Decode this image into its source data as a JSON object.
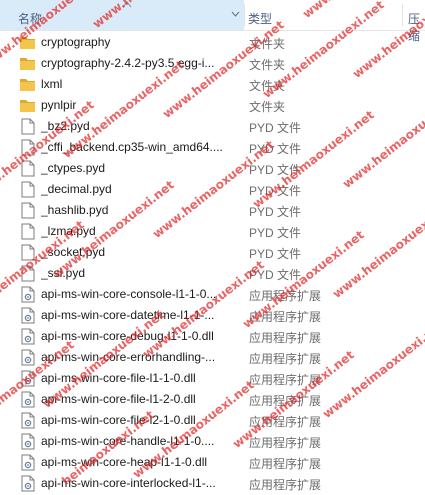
{
  "header": {
    "name_label": "名称",
    "type_label": "类型",
    "size_label": "压缩"
  },
  "colors": {
    "header_selected_bg": "#d9ebf9",
    "header_text": "#4d6082",
    "folder": "#f3c54b",
    "watermark": "#e22828"
  },
  "files": [
    {
      "name": "cryptography",
      "type": "文件夹",
      "icon": "folder-icon"
    },
    {
      "name": "cryptography-2.4.2-py3.5.egg-i...",
      "type": "文件夹",
      "icon": "folder-icon"
    },
    {
      "name": "lxml",
      "type": "文件夹",
      "icon": "folder-icon"
    },
    {
      "name": "pynlpir",
      "type": "文件夹",
      "icon": "folder-icon"
    },
    {
      "name": "_bz2.pyd",
      "type": "PYD 文件",
      "icon": "file-icon"
    },
    {
      "name": "_cffi_backend.cp35-win_amd64....",
      "type": "PYD 文件",
      "icon": "file-icon"
    },
    {
      "name": "_ctypes.pyd",
      "type": "PYD 文件",
      "icon": "file-icon"
    },
    {
      "name": "_decimal.pyd",
      "type": "PYD 文件",
      "icon": "file-icon"
    },
    {
      "name": "_hashlib.pyd",
      "type": "PYD 文件",
      "icon": "file-icon"
    },
    {
      "name": "_lzma.pyd",
      "type": "PYD 文件",
      "icon": "file-icon"
    },
    {
      "name": "_socket.pyd",
      "type": "PYD 文件",
      "icon": "file-icon"
    },
    {
      "name": "_ssl.pyd",
      "type": "PYD 文件",
      "icon": "file-icon"
    },
    {
      "name": "api-ms-win-core-console-l1-1-0...",
      "type": "应用程序扩展",
      "icon": "dll-icon"
    },
    {
      "name": "api-ms-win-core-datetime-l1-1-...",
      "type": "应用程序扩展",
      "icon": "dll-icon"
    },
    {
      "name": "api-ms-win-core-debug-l1-1-0.dll",
      "type": "应用程序扩展",
      "icon": "dll-icon"
    },
    {
      "name": "api-ms-win-core-errorhandling-...",
      "type": "应用程序扩展",
      "icon": "dll-icon"
    },
    {
      "name": "api-ms-win-core-file-l1-1-0.dll",
      "type": "应用程序扩展",
      "icon": "dll-icon"
    },
    {
      "name": "api-ms-win-core-file-l1-2-0.dll",
      "type": "应用程序扩展",
      "icon": "dll-icon"
    },
    {
      "name": "api-ms-win-core-file-l2-1-0.dll",
      "type": "应用程序扩展",
      "icon": "dll-icon"
    },
    {
      "name": "api-ms-win-core-handle-l1-1-0....",
      "type": "应用程序扩展",
      "icon": "dll-icon"
    },
    {
      "name": "api-ms-win-core-heap-l1-1-0.dll",
      "type": "应用程序扩展",
      "icon": "dll-icon"
    },
    {
      "name": "api-ms-win-core-interlocked-l1-...",
      "type": "应用程序扩展",
      "icon": "dll-icon"
    }
  ],
  "watermark_text": "www.heimaoxuexi.net"
}
